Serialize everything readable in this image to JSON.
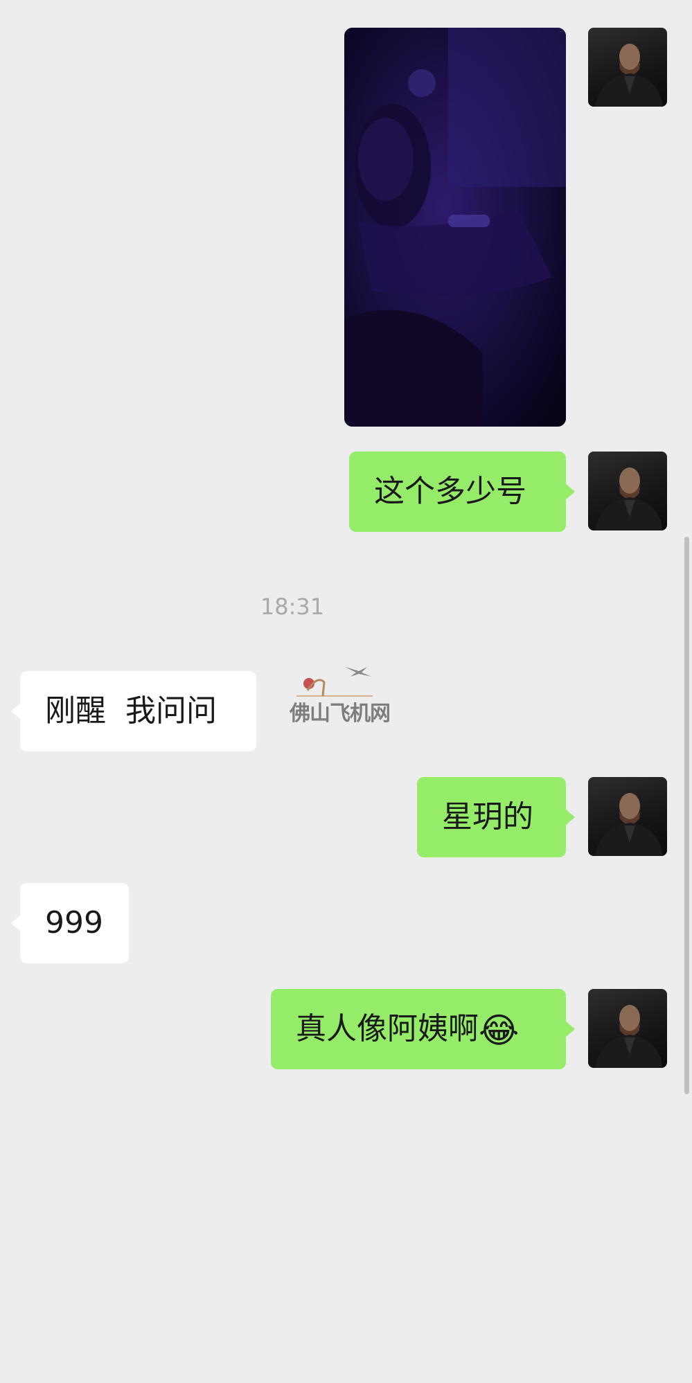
{
  "chat": {
    "timestamp": "18:31",
    "watermark": "佛山飞机网",
    "messages": [
      {
        "sender": "self",
        "kind": "photo",
        "label": ""
      },
      {
        "sender": "self",
        "kind": "text",
        "text": "这个多少号"
      },
      {
        "sender": "other",
        "kind": "text",
        "text": "刚醒  我问问"
      },
      {
        "sender": "self",
        "kind": "text",
        "text": "星玥的"
      },
      {
        "sender": "other",
        "kind": "text",
        "text": "999"
      },
      {
        "sender": "self",
        "kind": "text",
        "text": "真人像阿姨啊",
        "emoji": "😂"
      }
    ]
  },
  "colors": {
    "background": "#ededed",
    "outgoing_bubble": "#95ec69",
    "incoming_bubble": "#ffffff",
    "timestamp_text": "#a8a8a8"
  },
  "icons": {
    "avatar": "avatar-photo",
    "emoji": "tears-of-joy-emoji"
  }
}
